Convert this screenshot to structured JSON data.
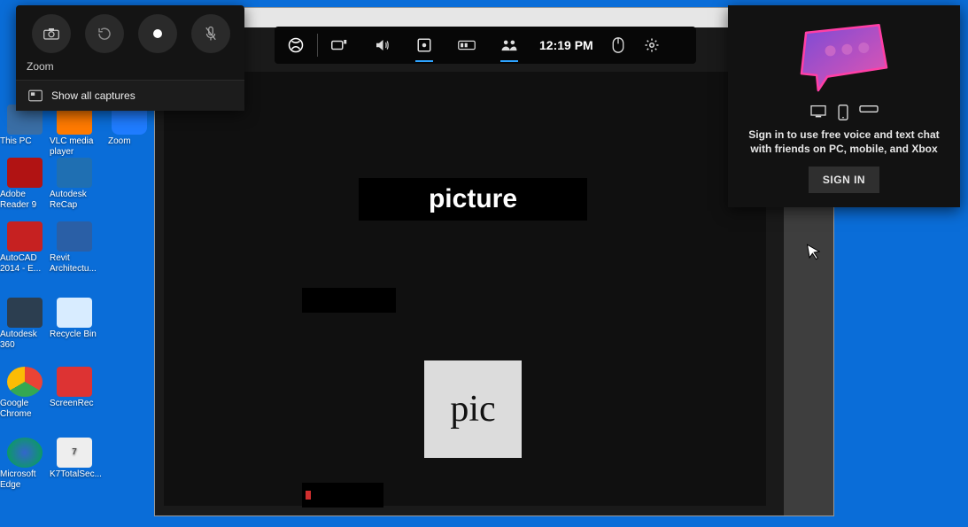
{
  "desktop": {
    "col_a": [
      {
        "label": "This PC"
      },
      {
        "label": "Adobe Reader 9"
      },
      {
        "label": "AutoCAD 2014 - E..."
      },
      {
        "label": "Autodesk 360"
      },
      {
        "label": "Google Chrome"
      },
      {
        "label": "Microsoft Edge"
      }
    ],
    "col_b": [
      {
        "label": "VLC media player"
      },
      {
        "label": "Autodesk ReCap"
      },
      {
        "label": "Revit Architectu..."
      },
      {
        "label": "Recycle Bin"
      },
      {
        "label": "ScreenRec"
      },
      {
        "label": "K7TotalSec..."
      }
    ],
    "col_c": [
      {
        "label": "Zoom"
      }
    ]
  },
  "capture": {
    "title": "Zoom",
    "screenshot_icon": "camera-icon",
    "last30_icon": "refresh-icon",
    "record_icon": "record-icon",
    "mic_icon": "mic-off-icon",
    "show_all_label": "Show all captures"
  },
  "gamebar": {
    "time": "12:19 PM",
    "buttons": [
      {
        "name": "xbox-icon"
      },
      {
        "name": "capture-widget-icon"
      },
      {
        "name": "audio-icon"
      },
      {
        "name": "performance-icon",
        "active": true
      },
      {
        "name": "resources-icon"
      },
      {
        "name": "social-icon",
        "active": true
      }
    ],
    "mouse_icon": "mouse-icon",
    "settings_icon": "gear-icon"
  },
  "window": {
    "minimize": "–",
    "maximize": "□",
    "content": {
      "picture_label": "picture",
      "pic_label": "pic"
    }
  },
  "social": {
    "message": "Sign in to use free voice and text chat with friends on PC, mobile, and Xbox",
    "signin_label": "SIGN IN"
  }
}
